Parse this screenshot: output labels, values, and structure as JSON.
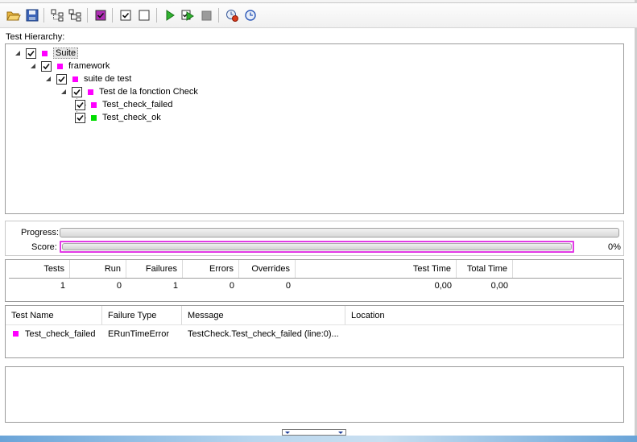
{
  "toolbar": {
    "buttons": [
      {
        "icon": "open-folder-icon"
      },
      {
        "icon": "save-icon"
      },
      {
        "icon": "expand-all-icon"
      },
      {
        "icon": "collapse-all-icon"
      },
      {
        "icon": "select-failed-icon"
      },
      {
        "icon": "check-all-icon"
      },
      {
        "icon": "uncheck-all-icon"
      },
      {
        "icon": "run-icon"
      },
      {
        "icon": "run-selected-icon"
      },
      {
        "icon": "stop-icon"
      },
      {
        "icon": "clear-results-icon"
      },
      {
        "icon": "timer-icon"
      }
    ]
  },
  "hierarchy": {
    "label": "Test Hierarchy:",
    "nodes": [
      {
        "name": "Suite",
        "level": 0,
        "checked": true,
        "status_color": "#ff00ff",
        "selected": true
      },
      {
        "name": "framework",
        "level": 1,
        "checked": true,
        "status_color": "#ff00ff"
      },
      {
        "name": "suite de test",
        "level": 2,
        "checked": true,
        "status_color": "#ff00ff"
      },
      {
        "name": "Test de la fonction Check",
        "level": 3,
        "checked": true,
        "status_color": "#ff00ff"
      },
      {
        "name": "Test_check_failed",
        "level": 4,
        "checked": true,
        "status_color": "#ff00ff"
      },
      {
        "name": "Test_check_ok",
        "level": 4,
        "checked": true,
        "status_color": "#00dd00"
      }
    ]
  },
  "progress": {
    "progress_label": "Progress:",
    "score_label": "Score:",
    "score_percent_text": "0%",
    "score_fraction": 0,
    "score_color": "#e23ae6"
  },
  "stats": {
    "headers": {
      "tests": "Tests",
      "run": "Run",
      "failures": "Failures",
      "errors": "Errors",
      "overrides": "Overrides",
      "test_time": "Test Time",
      "total_time": "Total Time"
    },
    "values": {
      "tests": "1",
      "run": "0",
      "failures": "1",
      "errors": "0",
      "overrides": "0",
      "test_time": "0,00",
      "total_time": "0,00"
    }
  },
  "failures": {
    "headers": {
      "test_name": "Test Name",
      "failure_type": "Failure Type",
      "message": "Message",
      "location": "Location"
    },
    "rows": [
      {
        "status_color": "#ff00ff",
        "test_name": "Test_check_failed",
        "failure_type": "ERunTimeError",
        "message": "TestCheck.Test_check_failed (line:0)...",
        "location": ""
      }
    ]
  }
}
